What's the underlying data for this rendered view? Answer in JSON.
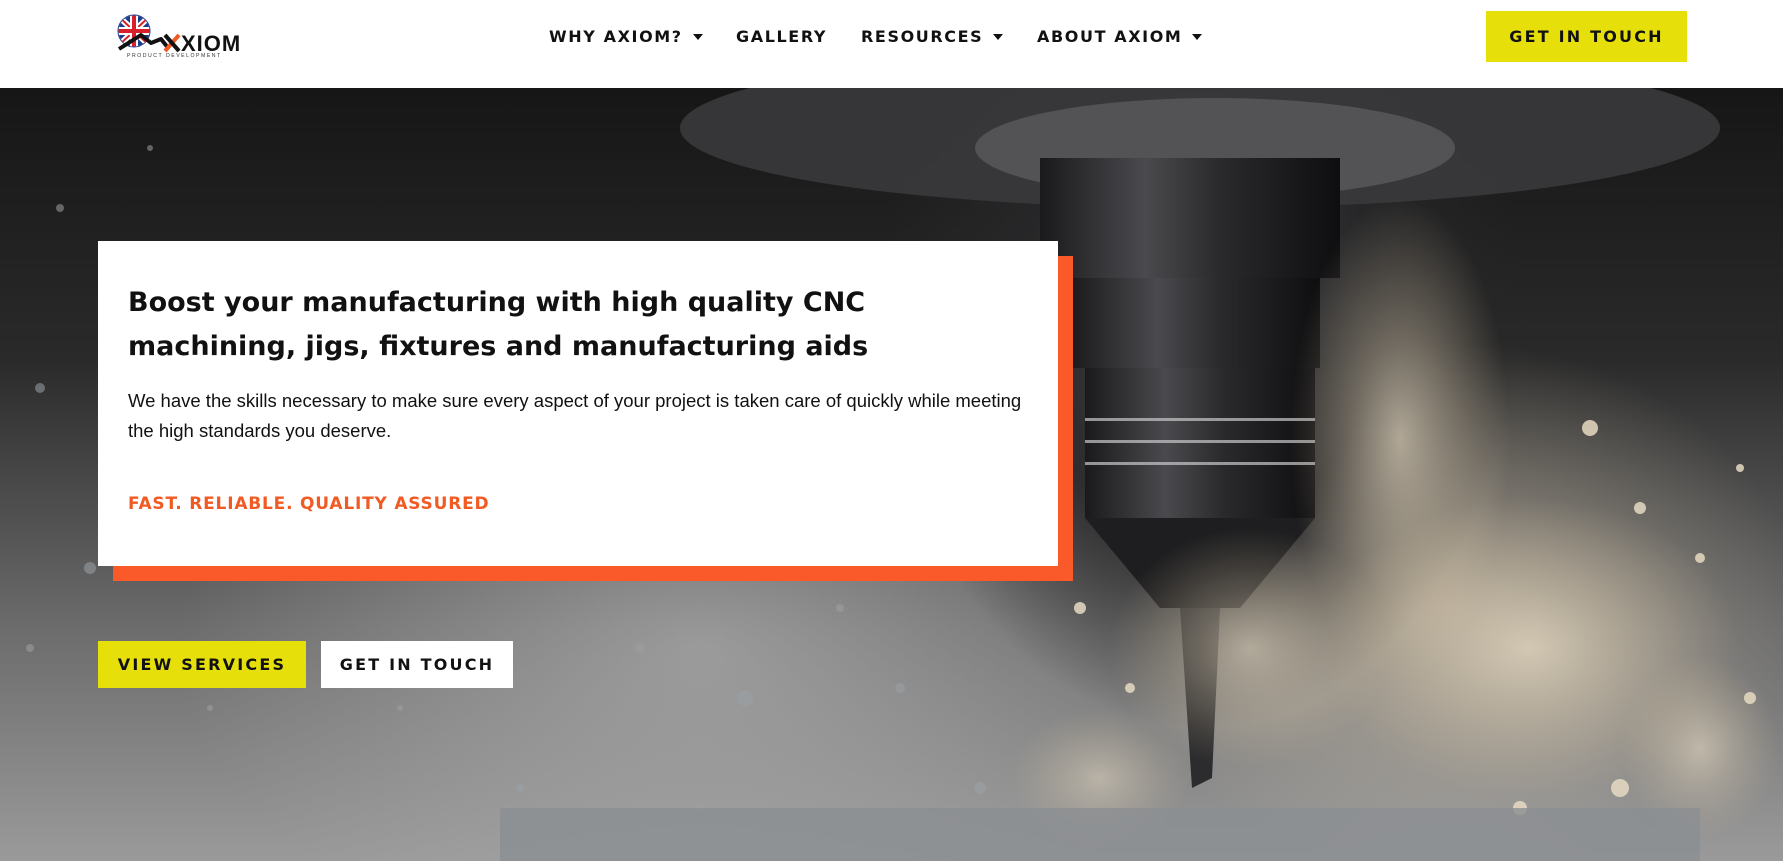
{
  "brand": {
    "logo_text": "XIOM",
    "logo_subtitle": "PRODUCT DEVELOPMENT",
    "accent_color": "#f25a24",
    "yellow_color": "#e6df0a"
  },
  "nav": {
    "items": [
      {
        "label": "WHY AXIOM?",
        "has_dropdown": true
      },
      {
        "label": "GALLERY",
        "has_dropdown": false
      },
      {
        "label": "RESOURCES",
        "has_dropdown": true
      },
      {
        "label": "ABOUT AXIOM",
        "has_dropdown": true
      }
    ],
    "cta_label": "GET IN TOUCH"
  },
  "hero": {
    "title": "Boost your manufacturing with high quality CNC machining, jigs, fixtures and manufacturing aids",
    "body": "We have the skills necessary to make sure every aspect of your project is taken care of quickly while meeting the high standards you deserve.",
    "tagline": "FAST. RELIABLE. QUALITY ASSURED",
    "primary_button": "VIEW SERVICES",
    "secondary_button": "GET IN TOUCH"
  }
}
